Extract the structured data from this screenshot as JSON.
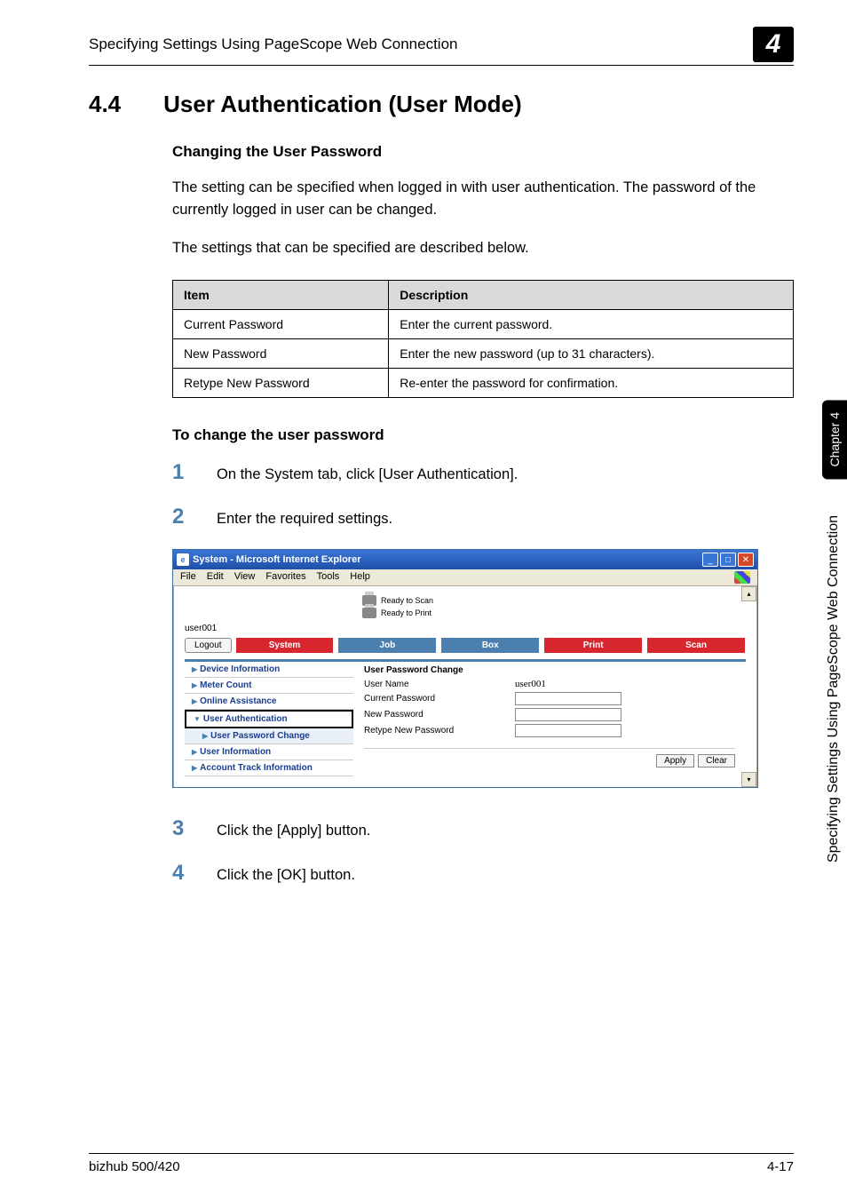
{
  "header": {
    "text": "Specifying Settings Using PageScope Web Connection",
    "chapter_num": "4"
  },
  "section": {
    "number": "4.4",
    "title": "User Authentication (User Mode)"
  },
  "subsection1": {
    "title": "Changing the User Password",
    "para1": "The setting can be specified when logged in with user authentication. The password of the currently logged in user can be changed.",
    "para2": "The settings that can be specified are described below."
  },
  "table": {
    "headers": [
      "Item",
      "Description"
    ],
    "rows": [
      [
        "Current Password",
        "Enter the current password."
      ],
      [
        "New Password",
        "Enter the new password (up to 31 characters)."
      ],
      [
        "Retype New Password",
        "Re-enter the password for confirmation."
      ]
    ]
  },
  "subsection2": {
    "title": "To change the user password"
  },
  "steps": {
    "s1": {
      "num": "1",
      "text": "On the System tab, click [User Authentication]."
    },
    "s2": {
      "num": "2",
      "text": "Enter the required settings."
    },
    "s3": {
      "num": "3",
      "text": "Click the [Apply] button."
    },
    "s4": {
      "num": "4",
      "text": "Click the [OK] button."
    }
  },
  "screenshot": {
    "title": "System - Microsoft Internet Explorer",
    "menu": {
      "file": "File",
      "edit": "Edit",
      "view": "View",
      "favorites": "Favorites",
      "tools": "Tools",
      "help": "Help"
    },
    "status": {
      "scan": "Ready to Scan",
      "print": "Ready to Print"
    },
    "user": "user001",
    "logout": "Logout",
    "tabs": {
      "system": "System",
      "job": "Job",
      "box": "Box",
      "print": "Print",
      "scan": "Scan"
    },
    "nav": {
      "device": "Device Information",
      "meter": "Meter Count",
      "online": "Online Assistance",
      "userauth": "User Authentication",
      "pwchange": "User Password Change",
      "userinfo": "User Information",
      "account": "Account Track Information"
    },
    "form": {
      "title": "User Password Change",
      "username_label": "User Name",
      "username_value": "user001",
      "current_label": "Current Password",
      "new_label": "New Password",
      "retype_label": "Retype New Password",
      "apply": "Apply",
      "clear": "Clear"
    }
  },
  "side": {
    "chapter": "Chapter 4",
    "text": "Specifying Settings Using PageScope Web Connection"
  },
  "footer": {
    "product": "bizhub 500/420",
    "page": "4-17"
  }
}
